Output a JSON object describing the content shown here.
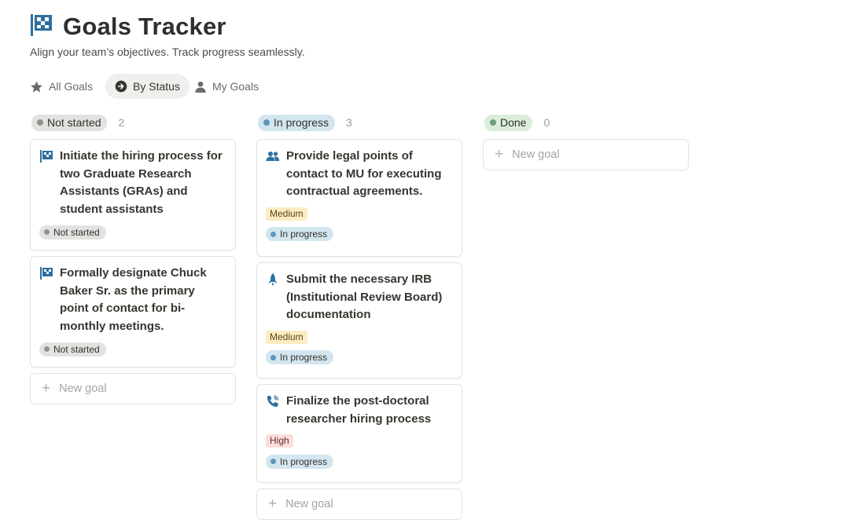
{
  "page": {
    "title": "Goals Tracker",
    "subtitle": "Align your team’s objectives. Track progress seamlessly.",
    "title_icon": "checkered-flag-icon"
  },
  "tabs": [
    {
      "label": "All Goals",
      "icon": "star-icon",
      "active": false
    },
    {
      "label": "By Status",
      "icon": "arrow-circle-icon",
      "active": true
    },
    {
      "label": "My Goals",
      "icon": "person-icon",
      "active": false
    }
  ],
  "columns": [
    {
      "status": "Not started",
      "count": "2",
      "color": "#91918e",
      "cards": [
        {
          "title": "Initiate the hiring process for two Graduate Research Assistants (GRAs) and student assistants",
          "icon": "checkered-flag-icon",
          "status": "Not started"
        },
        {
          "title": "Formally designate Chuck Baker Sr. as the primary point of contact for bi-monthly meetings.",
          "icon": "checkered-flag-icon",
          "status": "Not started"
        }
      ],
      "new_label": "New goal"
    },
    {
      "status": "In progress",
      "count": "3",
      "color": "#5b97bd",
      "cards": [
        {
          "title": "Provide legal points of contact to MU for executing contractual agreements.",
          "icon": "people-icon",
          "priority": "Medium",
          "status": "In progress"
        },
        {
          "title": "Submit the necessary IRB (Institutional Review Board) documentation",
          "icon": "rocket-icon",
          "priority": "Medium",
          "status": "In progress"
        },
        {
          "title": "Finalize the post-doctoral researcher hiring process",
          "icon": "phone-icon",
          "priority": "High",
          "status": "In progress"
        }
      ],
      "new_label": "New goal"
    },
    {
      "status": "Done",
      "count": "0",
      "color": "#6c9b7d",
      "cards": [],
      "new_label": "New goal"
    }
  ]
}
